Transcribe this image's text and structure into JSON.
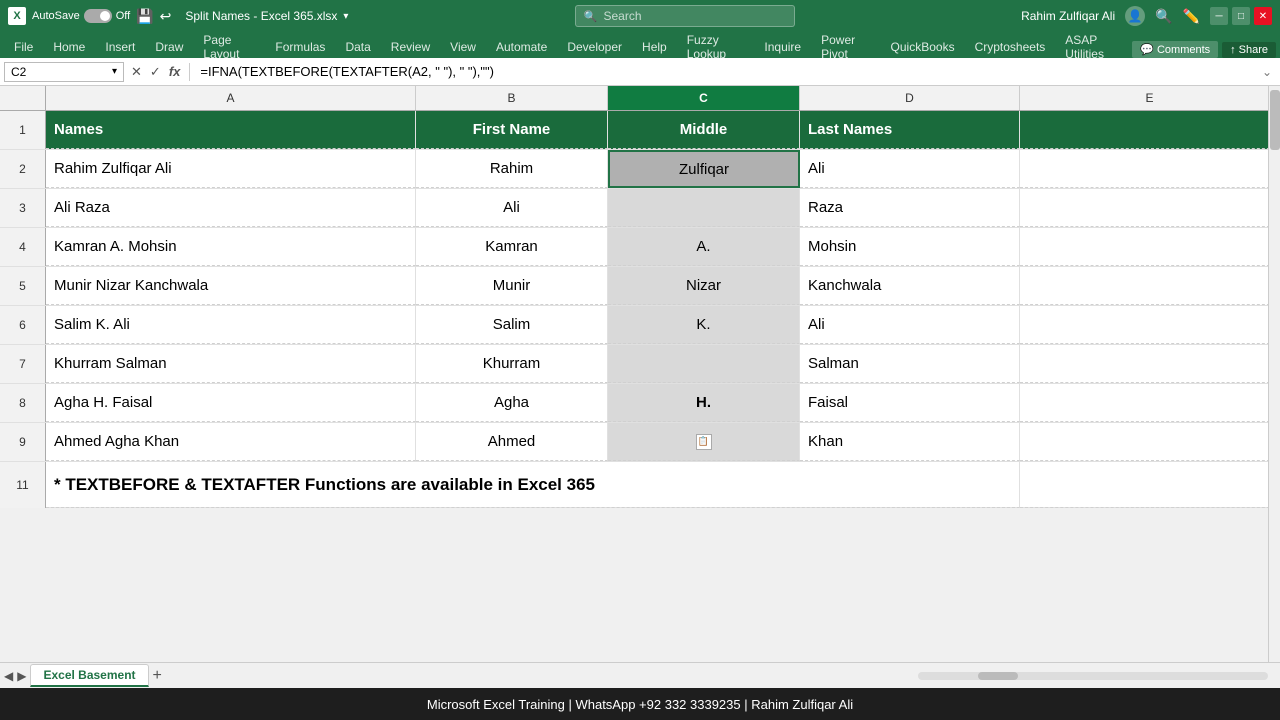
{
  "titleBar": {
    "logo": "X",
    "autosave_label": "AutoSave",
    "autosave_state": "Off",
    "save_icon": "💾",
    "file_title": "Split Names - Excel 365.xlsx",
    "search_placeholder": "Search",
    "user_name": "Rahim Zulfiqar Ali",
    "min_btn": "─",
    "max_btn": "□",
    "close_btn": "✕"
  },
  "ribbonTabs": [
    {
      "label": "File",
      "active": false
    },
    {
      "label": "Home",
      "active": false
    },
    {
      "label": "Insert",
      "active": false
    },
    {
      "label": "Draw",
      "active": false
    },
    {
      "label": "Page Layout",
      "active": false
    },
    {
      "label": "Formulas",
      "active": false
    },
    {
      "label": "Data",
      "active": false
    },
    {
      "label": "Review",
      "active": false
    },
    {
      "label": "View",
      "active": false
    },
    {
      "label": "Automate",
      "active": false
    },
    {
      "label": "Developer",
      "active": false
    },
    {
      "label": "Help",
      "active": false
    },
    {
      "label": "Fuzzy Lookup",
      "active": false
    },
    {
      "label": "Inquire",
      "active": false
    },
    {
      "label": "Power Pivot",
      "active": false
    },
    {
      "label": "QuickBooks",
      "active": false
    },
    {
      "label": "Cryptosheets",
      "active": false
    },
    {
      "label": "ASAP Utilities",
      "active": false
    }
  ],
  "ribbonRight": {
    "comments_label": "Comments",
    "share_label": "Share"
  },
  "formulaBar": {
    "cell_ref": "C2",
    "formula": "=IFNA(TEXTBEFORE(TEXTAFTER(A2, \" \"), \" \"),\"\")"
  },
  "columns": {
    "a_label": "A",
    "b_label": "B",
    "c_label": "C",
    "d_label": "D",
    "e_label": "E"
  },
  "headers": {
    "names": "Names",
    "first_name": "First Name",
    "middle": "Middle",
    "last_names": "Last Names"
  },
  "rows": [
    {
      "num": "2",
      "names": "Rahim Zulfiqar Ali",
      "first": "Rahim",
      "middle": "Zulfiqar",
      "last": "Ali"
    },
    {
      "num": "3",
      "names": "Ali Raza",
      "first": "Ali",
      "middle": "",
      "last": "Raza"
    },
    {
      "num": "4",
      "names": "Kamran A. Mohsin",
      "first": "Kamran",
      "middle": "A.",
      "last": "Mohsin"
    },
    {
      "num": "5",
      "names": "Munir Nizar Kanchwala",
      "first": "Munir",
      "middle": "Nizar",
      "last": "Kanchwala"
    },
    {
      "num": "6",
      "names": "Salim K. Ali",
      "first": "Salim",
      "middle": "K.",
      "last": "Ali"
    },
    {
      "num": "7",
      "names": "Khurram Salman",
      "first": "Khurram",
      "middle": "",
      "last": "Salman"
    },
    {
      "num": "8",
      "names": "Agha H. Faisal",
      "first": "Agha",
      "middle": "H.",
      "last": "Faisal"
    },
    {
      "num": "9",
      "names": "Ahmed Agha Khan",
      "first": "Ahmed",
      "middle": "",
      "last": "Khan"
    }
  ],
  "noteRow": {
    "num": "11",
    "text": "* TEXTBEFORE & TEXTAFTER Functions are available in Excel 365"
  },
  "sheetTabs": {
    "active_tab": "Excel Basement",
    "add_label": "+"
  },
  "statusBar": {
    "text": "Microsoft Excel Training | WhatsApp +92 332 3339235 | Rahim Zulfiqar Ali"
  }
}
